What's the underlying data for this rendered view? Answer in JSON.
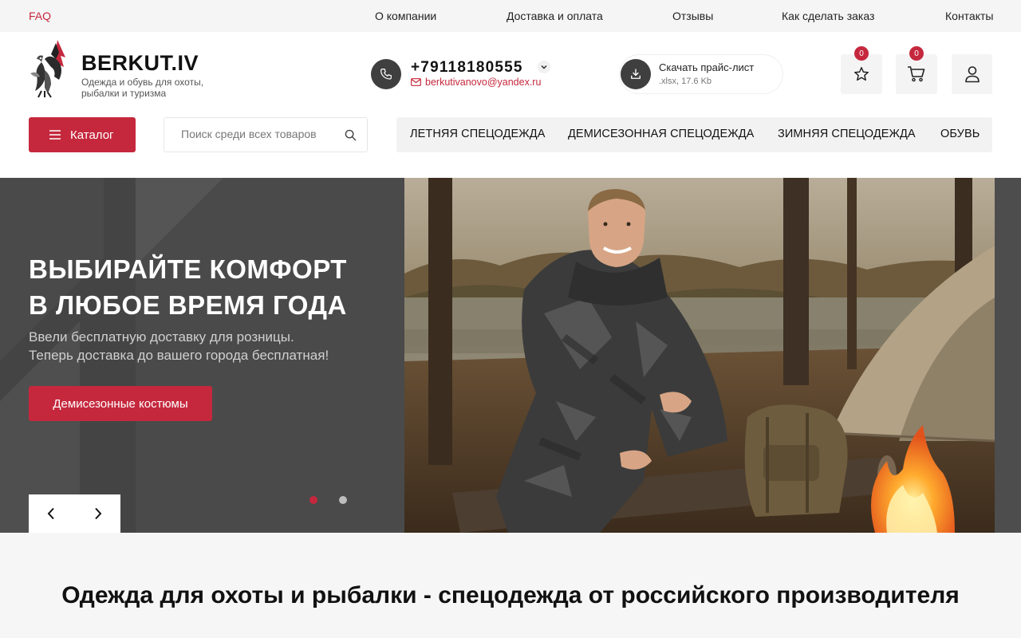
{
  "topbar": {
    "faq": "FAQ",
    "links": [
      "О компании",
      "Доставка и оплата",
      "Отзывы",
      "Как сделать заказ",
      "Контакты"
    ]
  },
  "brand": {
    "title": "BERKUT.IV",
    "subtitle": "Одежда и обувь для охоты, рыбалки и туризма"
  },
  "contact": {
    "phone": "+79118180555",
    "email": "berkutivanovo@yandex.ru",
    "icon": "phone-icon"
  },
  "price_list": {
    "title": "Скачать прайс-лист",
    "meta": ".xlsx, 17.6 Kb",
    "icon": "download-icon"
  },
  "actions": {
    "favorites_count": "0",
    "cart_count": "0"
  },
  "catalog": {
    "button_label": "Каталог",
    "search_placeholder": "Поиск среди всех товаров",
    "menu": [
      "ЛЕТНЯЯ СПЕЦОДЕЖДА",
      "ДЕМИСЕЗОННАЯ СПЕЦОДЕЖДА",
      "ЗИМНЯЯ СПЕЦОДЕЖДА",
      "ОБУВЬ"
    ]
  },
  "hero": {
    "title_line1": "ВЫБИРАЙТЕ КОМФОРТ",
    "title_line2": "В ЛЮБОЕ ВРЕМЯ ГОДА",
    "text_line1": "Ввели бесплатную доставку для розницы.",
    "text_line2": "Теперь доставка до вашего города бесплатная!",
    "cta": "Демисезонные костюмы",
    "slides": 2,
    "active_slide": 1
  },
  "section": {
    "heading": "Одежда для охоты и рыбалки - спецодежда от российского производителя"
  },
  "colors": {
    "accent": "#c5283d",
    "dark": "#3f3f3f",
    "hero_bg": "#4a4a4a"
  }
}
